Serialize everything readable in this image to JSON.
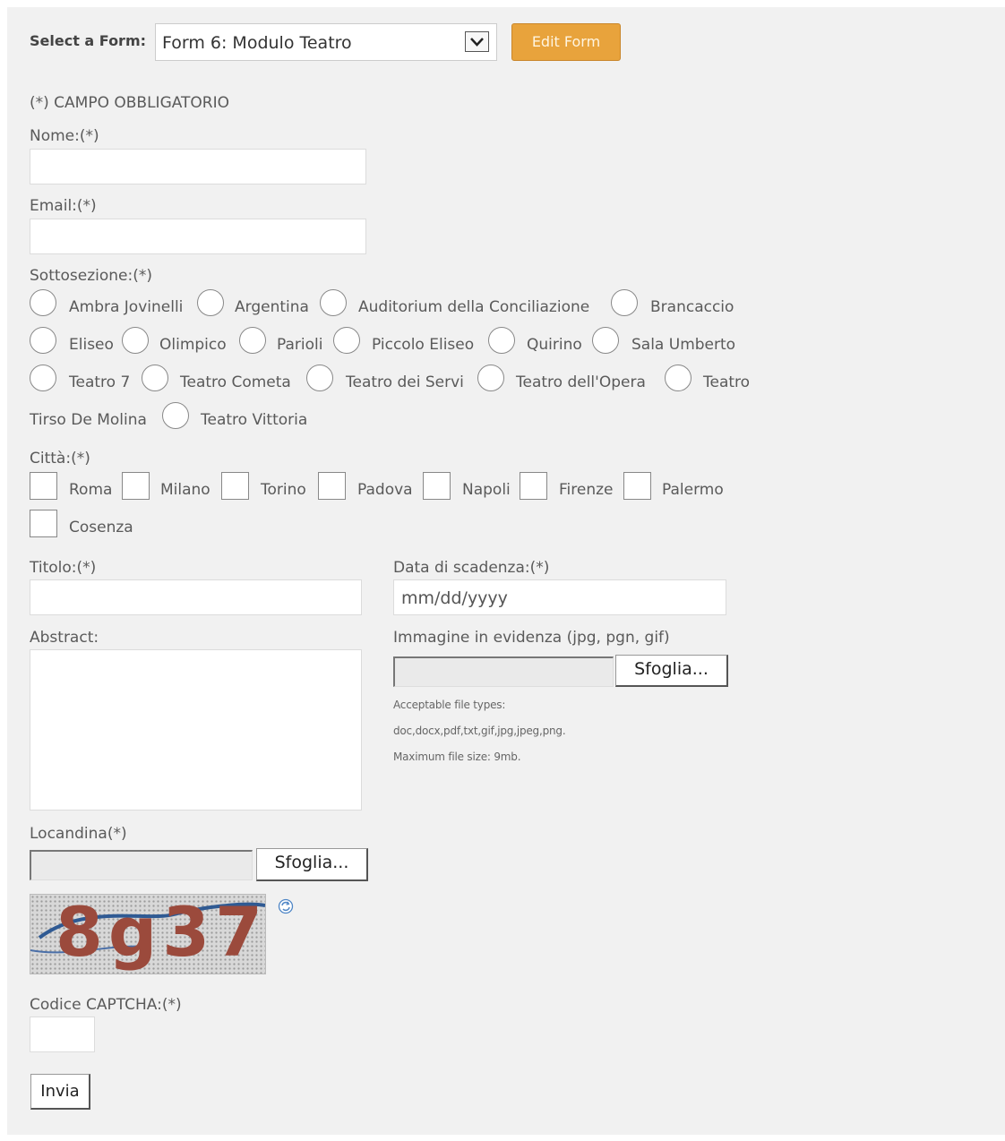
{
  "header": {
    "select_label": "Select a Form:",
    "selected_form": "Form 6: Modulo Teatro",
    "edit_button": "Edit Form",
    "accent": "#e8a33c"
  },
  "form": {
    "required_note": "(*) CAMPO OBBLIGATORIO",
    "nome_label": "Nome:(*)",
    "email_label": "Email:(*)",
    "sottosezione_label": "Sottosezione:(*)",
    "sottosezione_options": [
      "Ambra Jovinelli",
      "Argentina",
      "Auditorium della Conciliazione",
      "Brancaccio",
      "Eliseo",
      "Olimpico",
      "Parioli",
      "Piccolo Eliseo",
      "Quirino",
      "Sala Umberto",
      "Teatro 7",
      "Teatro Cometa",
      "Teatro dei Servi",
      "Teatro dell'Opera",
      "Teatro",
      "Tirso De Molina",
      "Teatro Vittoria"
    ],
    "citta_label": "Città:(*)",
    "citta_options": [
      "Roma",
      "Milano",
      "Torino",
      "Padova",
      "Napoli",
      "Firenze",
      "Palermo",
      "Cosenza"
    ],
    "titolo_label": "Titolo:(*)",
    "data_label": "Data di scadenza:(*)",
    "data_placeholder": "mm/dd/yyyy",
    "abstract_label": "Abstract:",
    "immagine_label": "Immagine in evidenza (jpg, pgn, gif)",
    "browse_button": "Sfoglia...",
    "file_types_1": "Acceptable file types:",
    "file_types_2": "doc,docx,pdf,txt,gif,jpg,jpeg,png.",
    "file_size": "Maximum file size: 9mb.",
    "locandina_label": "Locandina(*)",
    "captcha_text": "8g37",
    "captcha_label": "Codice CAPTCHA:(*)",
    "submit_button": "Invia"
  }
}
